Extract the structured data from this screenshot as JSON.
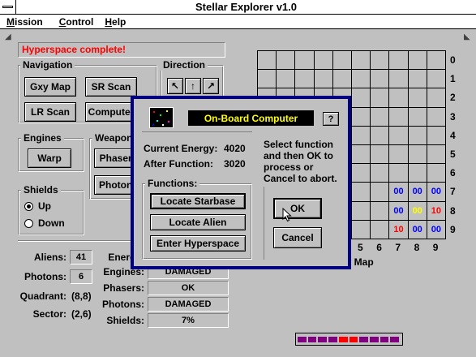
{
  "app": {
    "title": "Stellar Explorer v1.0"
  },
  "menubar": [
    {
      "label": "Mission",
      "underline": "M",
      "rest": "ission"
    },
    {
      "label": "Control",
      "underline": "C",
      "rest": "ontrol"
    },
    {
      "label": "Help",
      "underline": "H",
      "rest": "elp"
    }
  ],
  "status": {
    "message": "Hyperspace complete!"
  },
  "navigation": {
    "label": "Navigation",
    "buttons": [
      "Gxy Map",
      "SR Scan",
      "LR Scan",
      "Computer"
    ]
  },
  "direction": {
    "label": "Direction",
    "arrows": [
      "↖",
      "↑",
      "↗"
    ]
  },
  "engines": {
    "label": "Engines",
    "warp_label": "Warp"
  },
  "weapons": {
    "label": "Weapons",
    "buttons": [
      "Phasers",
      "Photons"
    ]
  },
  "shields": {
    "label": "Shields",
    "options": [
      "Up",
      "Down"
    ],
    "selected": "Up"
  },
  "stats_left": [
    {
      "label": "Aliens:",
      "value": "41"
    },
    {
      "label": "Photons:",
      "value": "6"
    },
    {
      "label": "Quadrant:",
      "value": "(8,8)"
    },
    {
      "label": "Sector:",
      "value": "(2,6)"
    }
  ],
  "stats_right": [
    {
      "label": "Energy:",
      "value": ""
    },
    {
      "label": "Engines:",
      "value": "DAMAGED"
    },
    {
      "label": "Phasers:",
      "value": "OK"
    },
    {
      "label": "Photons:",
      "value": "DAMAGED"
    },
    {
      "label": "Shields:",
      "value": "7%"
    }
  ],
  "galaxy": {
    "row_labels": [
      "0",
      "1",
      "2",
      "3",
      "4",
      "5",
      "6",
      "7",
      "8",
      "9"
    ],
    "col_labels": [
      "5",
      "6",
      "7",
      "8",
      "9"
    ],
    "caption": "xy Map",
    "cells": [
      {
        "row": 7,
        "col": 7,
        "text": "00",
        "color": "#0000ff"
      },
      {
        "row": 7,
        "col": 8,
        "text": "00",
        "color": "#0000ff"
      },
      {
        "row": 7,
        "col": 9,
        "text": "00",
        "color": "#0000ff"
      },
      {
        "row": 8,
        "col": 7,
        "text": "00",
        "color": "#0000ff"
      },
      {
        "row": 8,
        "col": 8,
        "text": "00",
        "color": "#ffff00"
      },
      {
        "row": 8,
        "col": 9,
        "text": "10",
        "color": "#ff0000"
      },
      {
        "row": 9,
        "col": 7,
        "text": "10",
        "color": "#ff0000"
      },
      {
        "row": 9,
        "col": 8,
        "text": "00",
        "color": "#0000ff"
      },
      {
        "row": 9,
        "col": 9,
        "text": "00",
        "color": "#0000ff"
      }
    ]
  },
  "dialog": {
    "title": "On-Board Computer",
    "help_label": "?",
    "current_energy_label": "Current Energy:",
    "current_energy_value": "4020",
    "after_function_label": "After Function:",
    "after_function_value": "3020",
    "instructions": [
      "Select function",
      "and then OK to",
      "process or",
      "Cancel to abort."
    ],
    "functions_label": "Functions:",
    "functions": [
      "Locate Starbase",
      "Locate Alien",
      "Enter Hyperspace"
    ],
    "ok_label": "OK",
    "cancel_label": "Cancel"
  },
  "energy_bar": {
    "colors": [
      "#800080",
      "#800080",
      "#800080",
      "#800080",
      "#ff0000",
      "#ff0000",
      "#800080",
      "#800080",
      "#800080",
      "#800080"
    ]
  }
}
